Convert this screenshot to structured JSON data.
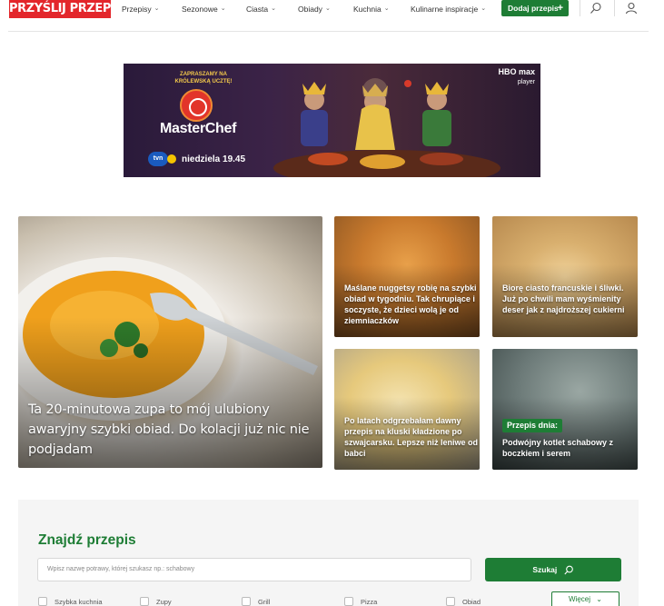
{
  "header": {
    "logo": "PRZYŚLIJ PRZEPIS!",
    "nav": [
      "Przepisy",
      "Sezonowe",
      "Ciasta",
      "Obiady",
      "Kuchnia",
      "Kulinarne inspiracje"
    ],
    "add_label": "Dodaj przepis",
    "add_icon": "plus-icon",
    "search_icon": "search-icon",
    "user_icon": "user-icon",
    "accent": "#1e7d35",
    "logo_color": "#e3262b"
  },
  "ad": {
    "invite": "ZAPRASZAMY NA KRÓLEWSKĄ UCZTĘ!",
    "brand": "MasterChef",
    "channel": "tvn",
    "when": "niedziela 19.45",
    "partner": "HBO max",
    "partner_sub": "player"
  },
  "cards": {
    "main": {
      "title": "Ta 20-minutowa zupa to mój ulubiony awaryjny szybki obiad. Do kolacji już nic nie podjadam"
    },
    "c1": {
      "title": "Maślane nuggetsy robię na szybki obiad w tygodniu. Tak chrupiące i soczyste, że dzieci wolą je od ziemniaczków"
    },
    "c2": {
      "title": "Biorę ciasto francuskie i śliwki. Już po chwili mam wyśmienity deser jak z najdroższej cukierni"
    },
    "c3": {
      "title": "Po latach odgrzebałam dawny przepis na kluski kładzione po szwajcarsku. Lepsze niż leniwe od babci"
    },
    "c4": {
      "badge": "Przepis dnia:",
      "title": "Podwójny kotlet schabowy z boczkiem i serem"
    }
  },
  "search": {
    "heading": "Znajdź przepis",
    "placeholder": "Wpisz nazwę potrawy, której szukasz np.: schabowy",
    "button": "Szukaj",
    "filters": [
      "Szybka kuchnia",
      "Zupy",
      "Grill",
      "Pizza",
      "Obiad"
    ],
    "more": "Więcej"
  }
}
